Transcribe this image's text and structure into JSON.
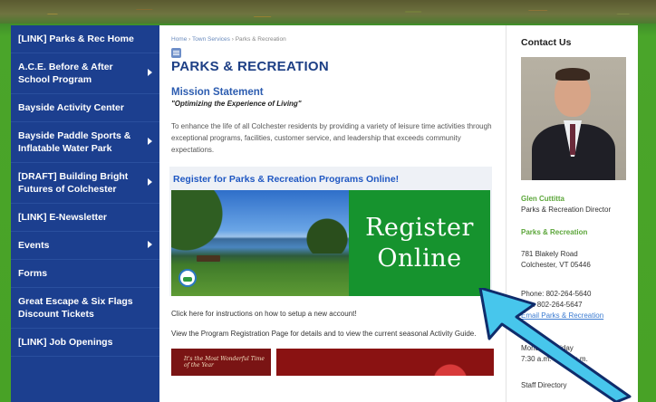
{
  "sidebar": {
    "items": [
      {
        "label": "[LINK] Parks & Rec Home",
        "has_submenu": false
      },
      {
        "label": "A.C.E. Before & After School Program",
        "has_submenu": true
      },
      {
        "label": "Bayside Activity Center",
        "has_submenu": false
      },
      {
        "label": "Bayside Paddle Sports & Inflatable Water Park",
        "has_submenu": true
      },
      {
        "label": "[DRAFT] Building Bright Futures of Colchester",
        "has_submenu": true
      },
      {
        "label": "[LINK] E-Newsletter",
        "has_submenu": false
      },
      {
        "label": "Events",
        "has_submenu": true
      },
      {
        "label": "Forms",
        "has_submenu": false
      },
      {
        "label": "Great Escape & Six Flags Discount Tickets",
        "has_submenu": false
      },
      {
        "label": "[LINK] Job Openings",
        "has_submenu": false
      }
    ]
  },
  "breadcrumb": {
    "home": "Home",
    "sep1": " › ",
    "services": "Town Services",
    "sep2": " › ",
    "current": "Parks & Recreation"
  },
  "main": {
    "title": "PARKS & RECREATION",
    "mission_heading": "Mission Statement",
    "mission_quote": "\"Optimizing the Experience of Living\"",
    "intro": "To enhance the life of all Colchester residents by providing a variety of leisure time activities through exceptional programs, facilities, customer service, and leadership that exceeds community expectations.",
    "register_heading": "Register for Parks & Recreation Programs Online!",
    "register_line1": "Register",
    "register_line2": "Online",
    "help_text": "Click here for instructions on how to setup a new account!",
    "view_text": "View the Program Registration Page for details and to view the current seasonal Activity Guide.",
    "xmas_text": "It's the Most Wonderful Time of the Year"
  },
  "contact": {
    "heading": "Contact Us",
    "name": "Glen Cuttitta",
    "role": "Parks & Recreation Director",
    "dept": "Parks & Recreation",
    "address1": "781 Blakely Road",
    "address2": "Colchester, VT 05446",
    "phone": "Phone: 802-264-5640",
    "fax": "Fax: 802-264-5647",
    "email_link": "Email Parks & Recreation",
    "hours_label": "Monday - Friday",
    "hours": "7:30 a.m. - 4:00 p.m.",
    "staff": "Staff Directory"
  },
  "colors": {
    "sidebar_bg": "#1c3f8f",
    "title": "#1d3f85",
    "accent_green": "#5ca63a",
    "register_green": "#16932e",
    "arrow": "#47c6ec"
  }
}
